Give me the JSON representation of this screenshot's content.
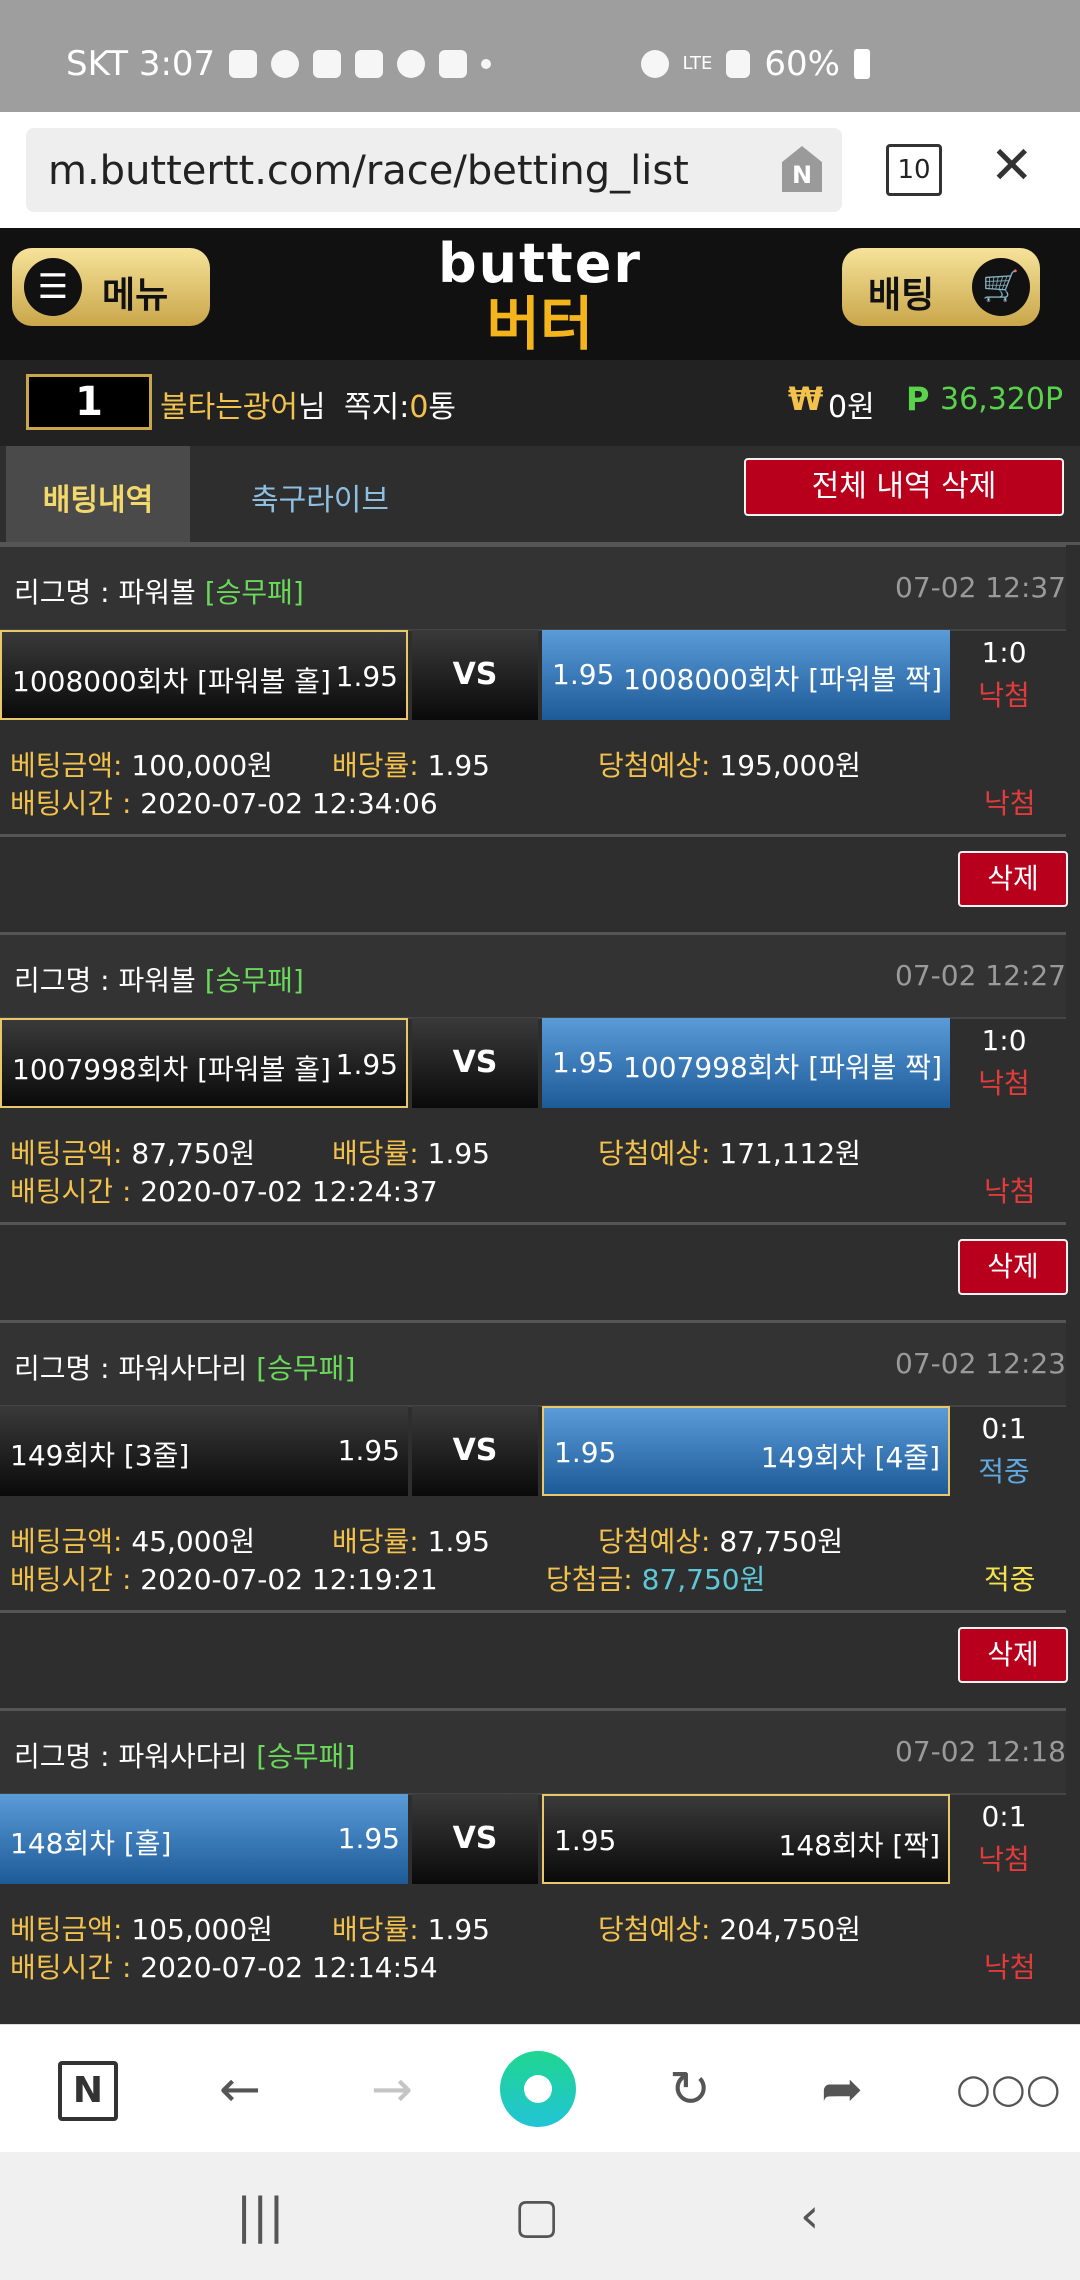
{
  "status_bar": {
    "carrier_time": "SKT 3:07",
    "battery": "60%",
    "signal": "LTE"
  },
  "browser": {
    "url": "m.buttertt.com/race/betting_list",
    "tab_count": "10",
    "n_badge": "N"
  },
  "site": {
    "menu_label": "메뉴",
    "bet_label": "배팅",
    "logo_en": "butter",
    "logo_ko": "버터"
  },
  "user": {
    "level": "1",
    "name": "불타는광어",
    "suffix": "님",
    "msg_label": "쪽지:",
    "msg_count": "0",
    "msg_unit": "통",
    "won_symbol": "₩",
    "won_value": "0원",
    "point_symbol": "P",
    "point_value": "36,320P"
  },
  "tabs": {
    "history": "배팅내역",
    "live": "축구라이브",
    "delete_all": "전체 내역 삭제"
  },
  "labels": {
    "league_prefix": "리그명 : ",
    "vs": "VS",
    "amount": "베팅금액:",
    "odds": "배당률:",
    "expected": "당첨예상:",
    "time": "배팅시간 :",
    "paid": "당첨금:",
    "delete": "삭제"
  },
  "bets": [
    {
      "league": "파워볼",
      "type": "[승무패]",
      "datetime": "07-02 12:37",
      "home": "1008000회차 [파워볼 홀]",
      "home_odds": "1.95",
      "away": "1008000회차 [파워볼 짝]",
      "away_odds": "1.95",
      "score": "1:0",
      "verdict": "낙첨",
      "amount": "100,000원",
      "odds": "1.95",
      "expected": "195,000원",
      "time": "2020-07-02 12:34:06",
      "result": "낙첨"
    },
    {
      "league": "파워볼",
      "type": "[승무패]",
      "datetime": "07-02 12:27",
      "home": "1007998회차 [파워볼 홀]",
      "home_odds": "1.95",
      "away": "1007998회차 [파워볼 짝]",
      "away_odds": "1.95",
      "score": "1:0",
      "verdict": "낙첨",
      "amount": "87,750원",
      "odds": "1.95",
      "expected": "171,112원",
      "time": "2020-07-02 12:24:37",
      "result": "낙첨"
    },
    {
      "league": "파워사다리",
      "type": "[승무패]",
      "datetime": "07-02 12:23",
      "home": "149회차 [3줄]",
      "home_odds": "1.95",
      "away": "149회차 [4줄]",
      "away_odds": "1.95",
      "score": "0:1",
      "verdict": "적중",
      "amount": "45,000원",
      "odds": "1.95",
      "expected": "87,750원",
      "time": "2020-07-02 12:19:21",
      "paid": "87,750원",
      "result": "적중"
    },
    {
      "league": "파워사다리",
      "type": "[승무패]",
      "datetime": "07-02 12:18",
      "home": "148회차 [홀]",
      "home_odds": "1.95",
      "away": "148회차 [짝]",
      "away_odds": "1.95",
      "score": "0:1",
      "verdict": "낙첨",
      "amount": "105,000원",
      "odds": "1.95",
      "expected": "204,750원",
      "time": "2020-07-02 12:14:54",
      "result": "낙첨"
    }
  ],
  "icons": {
    "back": "arrow-left-icon",
    "forward": "arrow-right-icon",
    "home": "naver-home-icon",
    "refresh": "refresh-icon",
    "share": "share-icon",
    "more": "more-icon"
  },
  "colors": {
    "lose": "#e23b3b",
    "win": "#5fa8e0",
    "gold": "#f3c24d",
    "red_button": "#b8001c"
  }
}
